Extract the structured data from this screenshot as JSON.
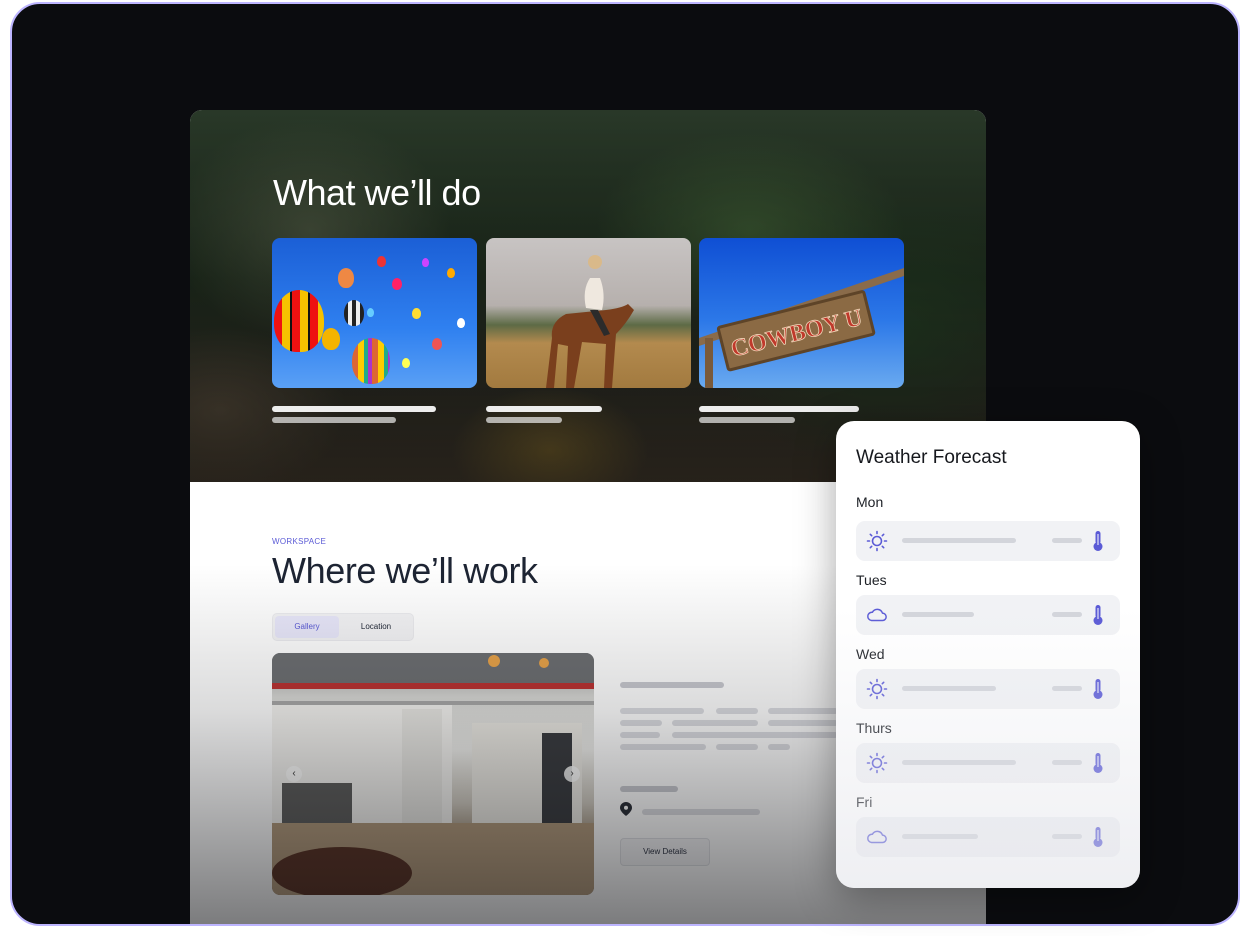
{
  "hero": {
    "title": "What we’ll do",
    "activities": [
      {
        "name": "hot-air-balloons"
      },
      {
        "name": "horse-riding"
      },
      {
        "name": "cowboy-u-sign",
        "sign_text": "COWBOY U"
      }
    ]
  },
  "work": {
    "eyebrow": "WORKSPACE",
    "title": "Where we’ll work",
    "tabs": [
      {
        "label": "Gallery",
        "active": true
      },
      {
        "label": "Location",
        "active": false
      }
    ],
    "gallery_prev": "‹",
    "gallery_next": "›",
    "view_details_label": "View Details"
  },
  "weather": {
    "title": "Weather Forecast",
    "days": [
      {
        "day": "Mon",
        "icon": "sun-icon"
      },
      {
        "day": "Tues",
        "icon": "cloud-icon"
      },
      {
        "day": "Wed",
        "icon": "sun-icon"
      },
      {
        "day": "Thurs",
        "icon": "sun-icon"
      },
      {
        "day": "Fri",
        "icon": "cloud-icon"
      }
    ]
  },
  "colors": {
    "accent": "#5b5bd6",
    "frame_border": "#bdb5ff",
    "background": "#0b0c0f"
  }
}
